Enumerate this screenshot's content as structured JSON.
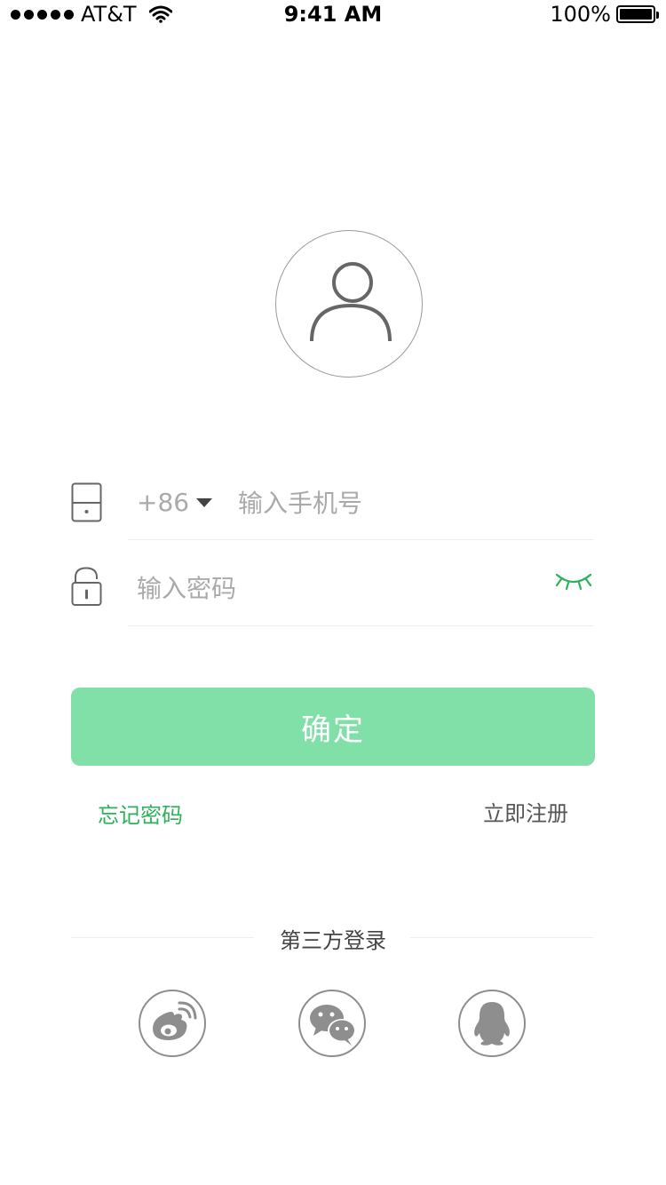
{
  "status_bar": {
    "carrier": "AT&T",
    "time": "9:41 AM",
    "battery": "100%"
  },
  "form": {
    "country_code": "+86",
    "phone_placeholder": "输入手机号",
    "password_placeholder": "输入密码"
  },
  "actions": {
    "confirm_label": "确定",
    "forgot_label": "忘记密码",
    "register_label": "立即注册"
  },
  "third_party": {
    "title": "第三方登录",
    "providers": [
      "weibo",
      "wechat",
      "qq"
    ]
  },
  "colors": {
    "accent": "#2db15b",
    "confirm_bg": "#81dfa8",
    "icon_gray": "#8e8e8e"
  },
  "icons": [
    "avatar-icon",
    "phone-icon",
    "lock-icon",
    "dropdown-caret-icon",
    "eye-closed-icon",
    "weibo-icon",
    "wechat-icon",
    "qq-icon"
  ]
}
